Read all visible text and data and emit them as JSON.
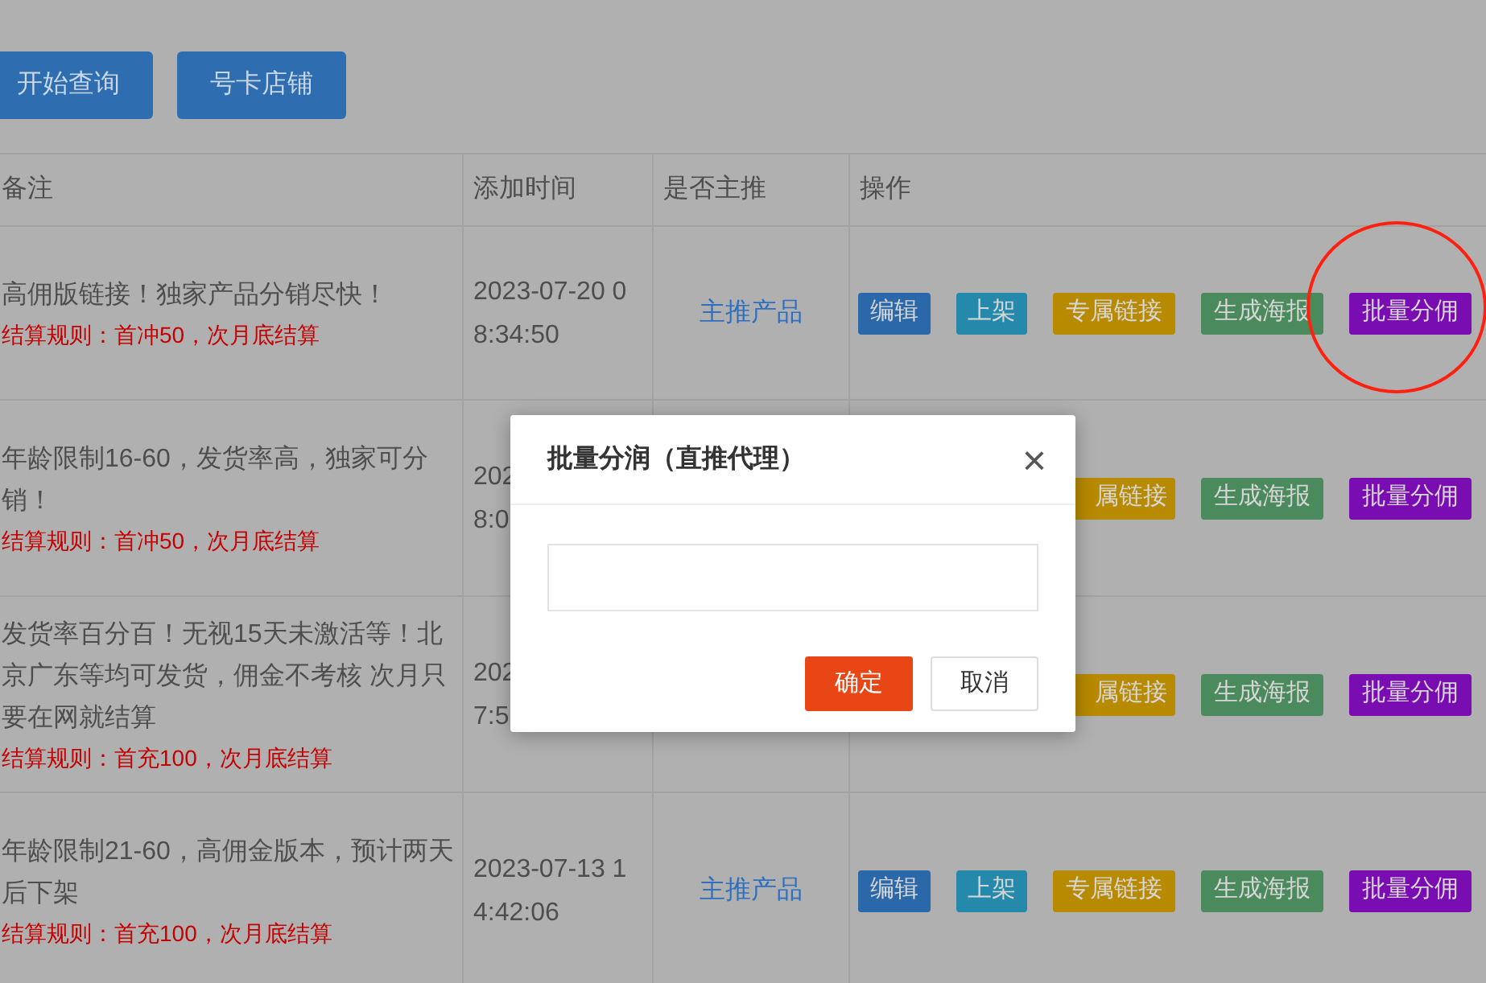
{
  "toolbar": {
    "buttons": [
      "开始查询",
      "号卡店铺"
    ]
  },
  "table": {
    "columns": [
      "备注",
      "添加时间",
      "是否主推",
      "操作"
    ],
    "rows": [
      {
        "note": "高佣版链接！独家产品分销尽快！",
        "rule": "结算规则：首冲50，次月底结算",
        "time_lines": [
          "2023-07-20 0",
          "8:34:50"
        ],
        "featured": "主推产品",
        "actions": [
          {
            "kind": "edit",
            "label": "编辑"
          },
          {
            "kind": "shelve",
            "label": "上架"
          },
          {
            "kind": "link",
            "label": "专属链接"
          },
          {
            "kind": "poster",
            "label": "生成海报"
          },
          {
            "kind": "split",
            "label": "批量分佣",
            "highlighted": true
          }
        ]
      },
      {
        "note": "年龄限制16-60，发货率高，独家可分销！",
        "rule": "结算规则：首冲50，次月底结算",
        "time_lines": [
          "202",
          "8:0"
        ],
        "actions": [
          {
            "kind": "link",
            "label": "属链接",
            "cut": true
          },
          {
            "kind": "poster",
            "label": "生成海报"
          },
          {
            "kind": "split",
            "label": "批量分佣"
          }
        ]
      },
      {
        "note": "发货率百分百！无视15天未激活等！北京广东等均可发货，佣金不考核 次月只要在网就结算",
        "rule": "结算规则：首充100，次月底结算",
        "time_lines": [
          "202",
          "7:5"
        ],
        "actions": [
          {
            "kind": "link",
            "label": "属链接",
            "cut": true
          },
          {
            "kind": "poster",
            "label": "生成海报"
          },
          {
            "kind": "split",
            "label": "批量分佣"
          }
        ]
      },
      {
        "note": "年龄限制21-60，高佣金版本，预计两天后下架",
        "rule": "结算规则：首充100，次月底结算",
        "time_lines": [
          "2023-07-13 1",
          "4:42:06"
        ],
        "featured": "主推产品",
        "actions": [
          {
            "kind": "edit",
            "label": "编辑"
          },
          {
            "kind": "shelve",
            "label": "上架"
          },
          {
            "kind": "link",
            "label": "专属链接"
          },
          {
            "kind": "poster",
            "label": "生成海报"
          },
          {
            "kind": "split",
            "label": "批量分佣"
          }
        ]
      }
    ]
  },
  "dialog": {
    "title": "批量分润（直推代理）",
    "close": "×",
    "confirm": "确定",
    "cancel": "取消"
  }
}
